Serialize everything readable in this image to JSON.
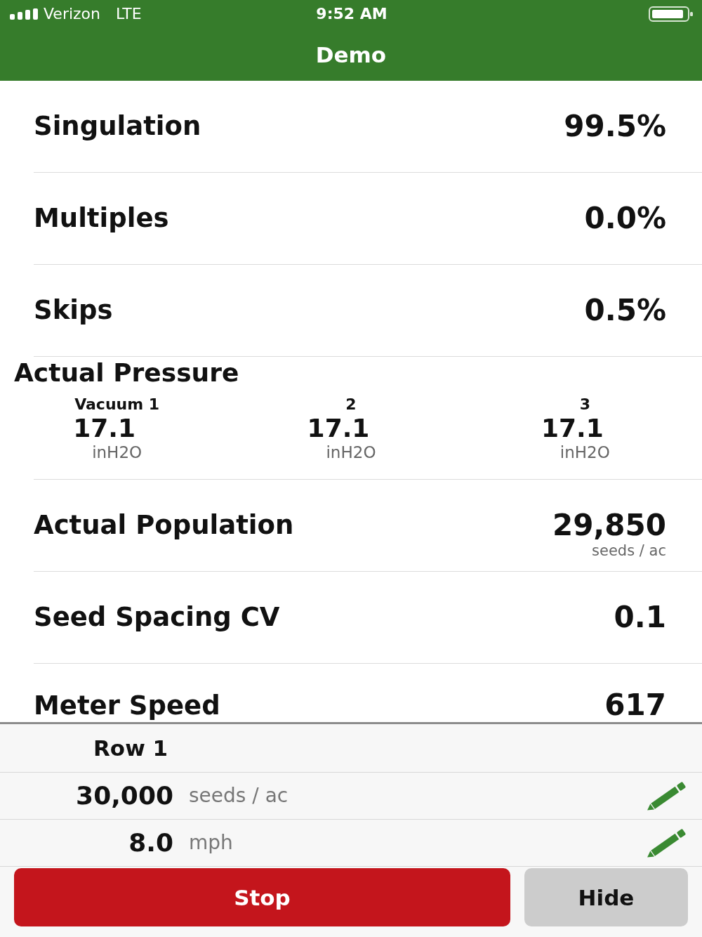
{
  "status_bar": {
    "carrier": "Verizon",
    "network": "LTE",
    "time": "9:52 AM"
  },
  "nav_bar": {
    "title": "Demo"
  },
  "metrics": [
    {
      "kind": "simple",
      "label": "Singulation",
      "value": "99.5%"
    },
    {
      "kind": "simple",
      "label": "Multiples",
      "value": "0.0%"
    },
    {
      "kind": "simple",
      "label": "Skips",
      "value": "0.5%"
    },
    {
      "kind": "pressure",
      "label": "Actual Pressure",
      "gauges": [
        {
          "label": "Vacuum 1",
          "value": "17.1",
          "unit": "inH2O"
        },
        {
          "label": "2",
          "value": "17.1",
          "unit": "inH2O"
        },
        {
          "label": "3",
          "value": "17.1",
          "unit": "inH2O"
        }
      ]
    },
    {
      "kind": "simple",
      "label": "Actual Population",
      "value": "29,850",
      "unit": "seeds / ac"
    },
    {
      "kind": "simple",
      "label": "Seed Spacing CV",
      "value": "0.1"
    },
    {
      "kind": "simple",
      "label": "Meter Speed",
      "value": "617"
    }
  ],
  "row_panel": {
    "title": "Row 1",
    "settings": [
      {
        "value": "30,000",
        "unit": "seeds / ac"
      },
      {
        "value": "8.0",
        "unit": "mph"
      }
    ]
  },
  "buttons": [
    {
      "kind": "stop",
      "label": "Stop"
    },
    {
      "kind": "hide",
      "label": "Hide"
    }
  ]
}
